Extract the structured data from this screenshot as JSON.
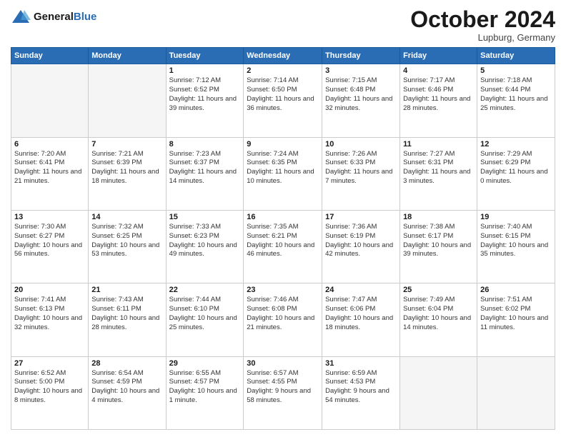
{
  "header": {
    "logo_line1": "General",
    "logo_line2": "Blue",
    "month": "October 2024",
    "location": "Lupburg, Germany"
  },
  "weekdays": [
    "Sunday",
    "Monday",
    "Tuesday",
    "Wednesday",
    "Thursday",
    "Friday",
    "Saturday"
  ],
  "weeks": [
    [
      {
        "day": "",
        "info": ""
      },
      {
        "day": "",
        "info": ""
      },
      {
        "day": "1",
        "info": "Sunrise: 7:12 AM\nSunset: 6:52 PM\nDaylight: 11 hours and 39 minutes."
      },
      {
        "day": "2",
        "info": "Sunrise: 7:14 AM\nSunset: 6:50 PM\nDaylight: 11 hours and 36 minutes."
      },
      {
        "day": "3",
        "info": "Sunrise: 7:15 AM\nSunset: 6:48 PM\nDaylight: 11 hours and 32 minutes."
      },
      {
        "day": "4",
        "info": "Sunrise: 7:17 AM\nSunset: 6:46 PM\nDaylight: 11 hours and 28 minutes."
      },
      {
        "day": "5",
        "info": "Sunrise: 7:18 AM\nSunset: 6:44 PM\nDaylight: 11 hours and 25 minutes."
      }
    ],
    [
      {
        "day": "6",
        "info": "Sunrise: 7:20 AM\nSunset: 6:41 PM\nDaylight: 11 hours and 21 minutes."
      },
      {
        "day": "7",
        "info": "Sunrise: 7:21 AM\nSunset: 6:39 PM\nDaylight: 11 hours and 18 minutes."
      },
      {
        "day": "8",
        "info": "Sunrise: 7:23 AM\nSunset: 6:37 PM\nDaylight: 11 hours and 14 minutes."
      },
      {
        "day": "9",
        "info": "Sunrise: 7:24 AM\nSunset: 6:35 PM\nDaylight: 11 hours and 10 minutes."
      },
      {
        "day": "10",
        "info": "Sunrise: 7:26 AM\nSunset: 6:33 PM\nDaylight: 11 hours and 7 minutes."
      },
      {
        "day": "11",
        "info": "Sunrise: 7:27 AM\nSunset: 6:31 PM\nDaylight: 11 hours and 3 minutes."
      },
      {
        "day": "12",
        "info": "Sunrise: 7:29 AM\nSunset: 6:29 PM\nDaylight: 11 hours and 0 minutes."
      }
    ],
    [
      {
        "day": "13",
        "info": "Sunrise: 7:30 AM\nSunset: 6:27 PM\nDaylight: 10 hours and 56 minutes."
      },
      {
        "day": "14",
        "info": "Sunrise: 7:32 AM\nSunset: 6:25 PM\nDaylight: 10 hours and 53 minutes."
      },
      {
        "day": "15",
        "info": "Sunrise: 7:33 AM\nSunset: 6:23 PM\nDaylight: 10 hours and 49 minutes."
      },
      {
        "day": "16",
        "info": "Sunrise: 7:35 AM\nSunset: 6:21 PM\nDaylight: 10 hours and 46 minutes."
      },
      {
        "day": "17",
        "info": "Sunrise: 7:36 AM\nSunset: 6:19 PM\nDaylight: 10 hours and 42 minutes."
      },
      {
        "day": "18",
        "info": "Sunrise: 7:38 AM\nSunset: 6:17 PM\nDaylight: 10 hours and 39 minutes."
      },
      {
        "day": "19",
        "info": "Sunrise: 7:40 AM\nSunset: 6:15 PM\nDaylight: 10 hours and 35 minutes."
      }
    ],
    [
      {
        "day": "20",
        "info": "Sunrise: 7:41 AM\nSunset: 6:13 PM\nDaylight: 10 hours and 32 minutes."
      },
      {
        "day": "21",
        "info": "Sunrise: 7:43 AM\nSunset: 6:11 PM\nDaylight: 10 hours and 28 minutes."
      },
      {
        "day": "22",
        "info": "Sunrise: 7:44 AM\nSunset: 6:10 PM\nDaylight: 10 hours and 25 minutes."
      },
      {
        "day": "23",
        "info": "Sunrise: 7:46 AM\nSunset: 6:08 PM\nDaylight: 10 hours and 21 minutes."
      },
      {
        "day": "24",
        "info": "Sunrise: 7:47 AM\nSunset: 6:06 PM\nDaylight: 10 hours and 18 minutes."
      },
      {
        "day": "25",
        "info": "Sunrise: 7:49 AM\nSunset: 6:04 PM\nDaylight: 10 hours and 14 minutes."
      },
      {
        "day": "26",
        "info": "Sunrise: 7:51 AM\nSunset: 6:02 PM\nDaylight: 10 hours and 11 minutes."
      }
    ],
    [
      {
        "day": "27",
        "info": "Sunrise: 6:52 AM\nSunset: 5:00 PM\nDaylight: 10 hours and 8 minutes."
      },
      {
        "day": "28",
        "info": "Sunrise: 6:54 AM\nSunset: 4:59 PM\nDaylight: 10 hours and 4 minutes."
      },
      {
        "day": "29",
        "info": "Sunrise: 6:55 AM\nSunset: 4:57 PM\nDaylight: 10 hours and 1 minute."
      },
      {
        "day": "30",
        "info": "Sunrise: 6:57 AM\nSunset: 4:55 PM\nDaylight: 9 hours and 58 minutes."
      },
      {
        "day": "31",
        "info": "Sunrise: 6:59 AM\nSunset: 4:53 PM\nDaylight: 9 hours and 54 minutes."
      },
      {
        "day": "",
        "info": ""
      },
      {
        "day": "",
        "info": ""
      }
    ]
  ]
}
